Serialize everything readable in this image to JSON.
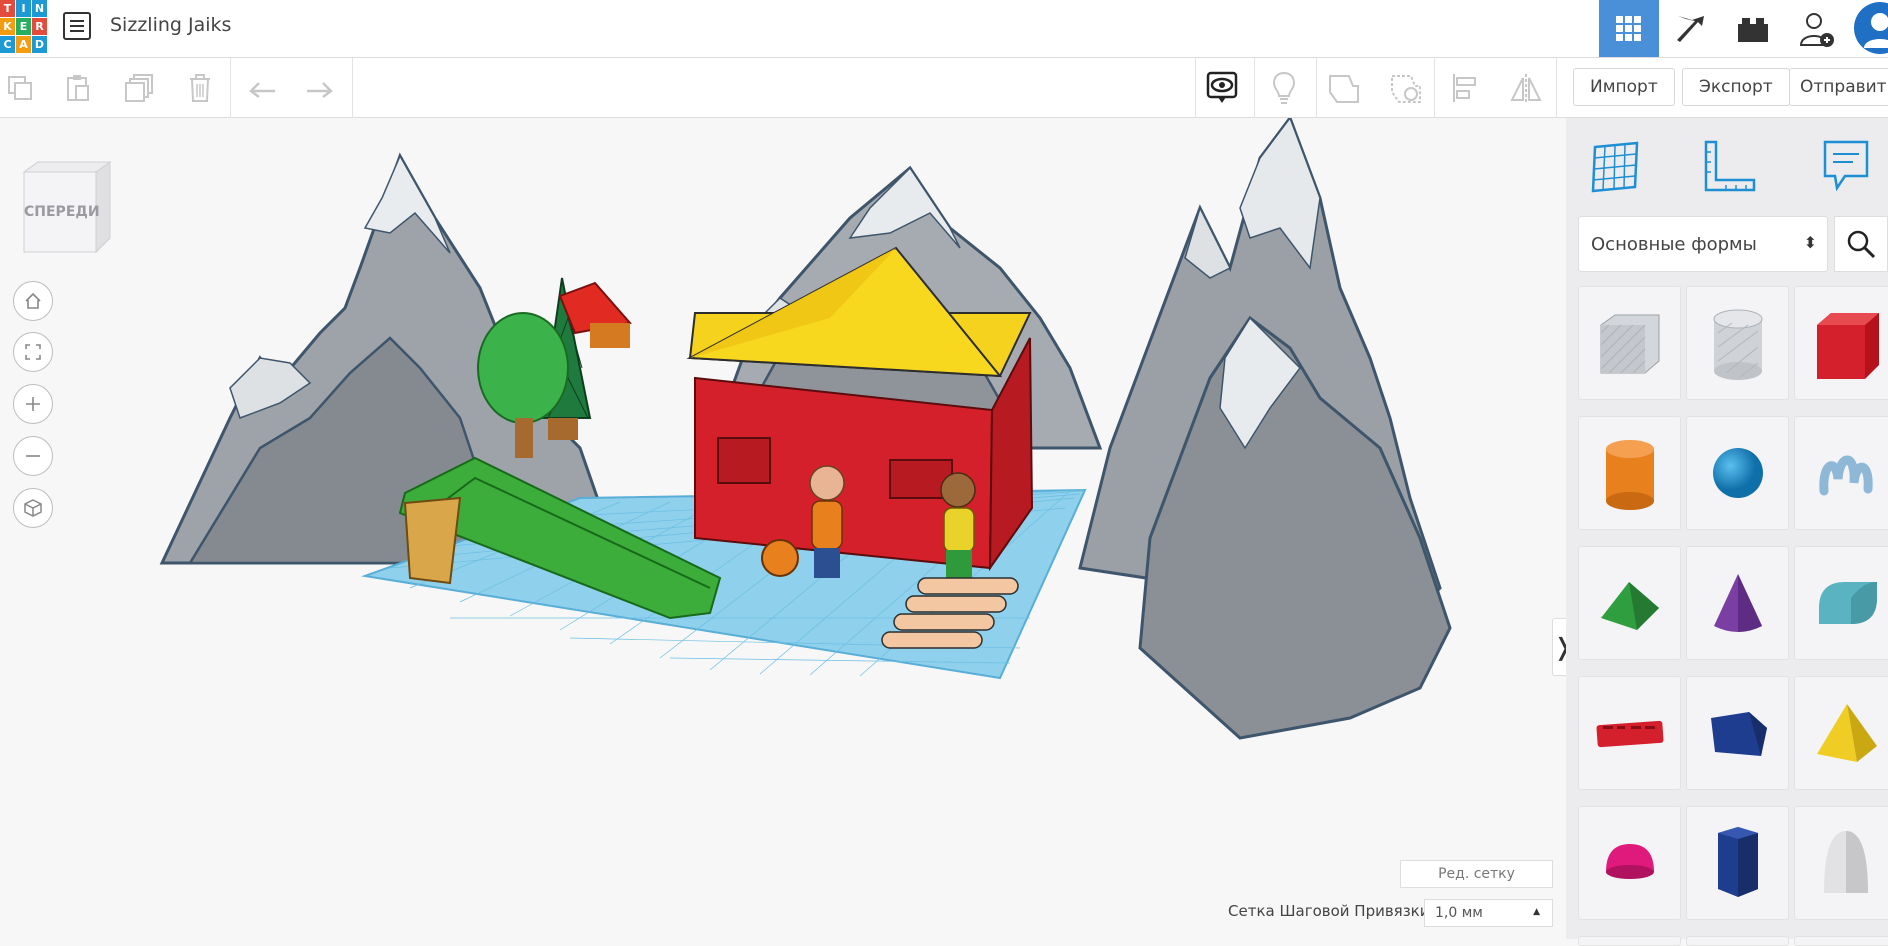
{
  "app": {
    "logo_letters": [
      "T",
      "I",
      "N",
      "K",
      "E",
      "R",
      "C",
      "A",
      "D"
    ],
    "logo_colors": [
      "#e34c3d",
      "#1d9ad6",
      "#1d9ad6",
      "#f39c12",
      "#27ae60",
      "#e34c3d",
      "#1d9ad6",
      "#f39c12",
      "#1d9ad6"
    ],
    "design_title": "Sizzling Jaiks"
  },
  "topnav": {
    "items": [
      "grid-view-icon",
      "pickaxe-icon",
      "lego-brick-icon",
      "add-user-icon",
      "avatar-icon"
    ],
    "active": "grid-view-icon",
    "accent_color": "#4a90d9"
  },
  "toolbar": {
    "edit_icons": [
      "copy-icon",
      "paste-icon",
      "duplicate-icon",
      "delete-icon",
      "undo-icon",
      "redo-icon"
    ],
    "view_icons": [
      "notes-visibility-icon",
      "light-bulb-icon",
      "shape-solid-icon",
      "shape-hole-icon",
      "align-icon",
      "mirror-icon"
    ],
    "import_label": "Импорт",
    "export_label": "Экспорт",
    "send_label": "Отправить"
  },
  "workplane": {
    "viewcube_label": "СПЕРЕДИ",
    "view_buttons": [
      "home-view-icon",
      "fit-all-icon",
      "zoom-in-icon",
      "zoom-out-icon",
      "perspective-icon"
    ],
    "edit_grid_label": "Ред. сетку",
    "snap_grid_label": "Сетка Шаговой Привязки",
    "snap_grid_value": "1,0 мм",
    "collapse_glyph": "❭"
  },
  "shapes_panel": {
    "panel_icons": [
      "workplane-icon",
      "ruler-icon",
      "note-icon"
    ],
    "category_select": "Основные формы",
    "search_icon": "search-icon",
    "shapes": [
      {
        "name": "box-hole",
        "color": "#c7cbd1"
      },
      {
        "name": "cylinder-hole",
        "color": "#cfd2d6"
      },
      {
        "name": "box",
        "color": "#d4202c"
      },
      {
        "name": "cylinder",
        "color": "#e8801e"
      },
      {
        "name": "sphere",
        "color": "#1b8fd2"
      },
      {
        "name": "scribble",
        "color": "#8fb8d6"
      },
      {
        "name": "roof",
        "color": "#2e9e3e"
      },
      {
        "name": "cone",
        "color": "#7b3fa4"
      },
      {
        "name": "round-roof",
        "color": "#5ab3c0"
      },
      {
        "name": "text",
        "color": "#d4202c"
      },
      {
        "name": "polygon",
        "color": "#1f3d8f"
      },
      {
        "name": "pyramid",
        "color": "#e8c21a"
      },
      {
        "name": "half-sphere",
        "color": "#e0197d"
      },
      {
        "name": "hexagonal-prism",
        "color": "#1f3d8f"
      },
      {
        "name": "paraboloid",
        "color": "#dcdcdc"
      }
    ]
  }
}
